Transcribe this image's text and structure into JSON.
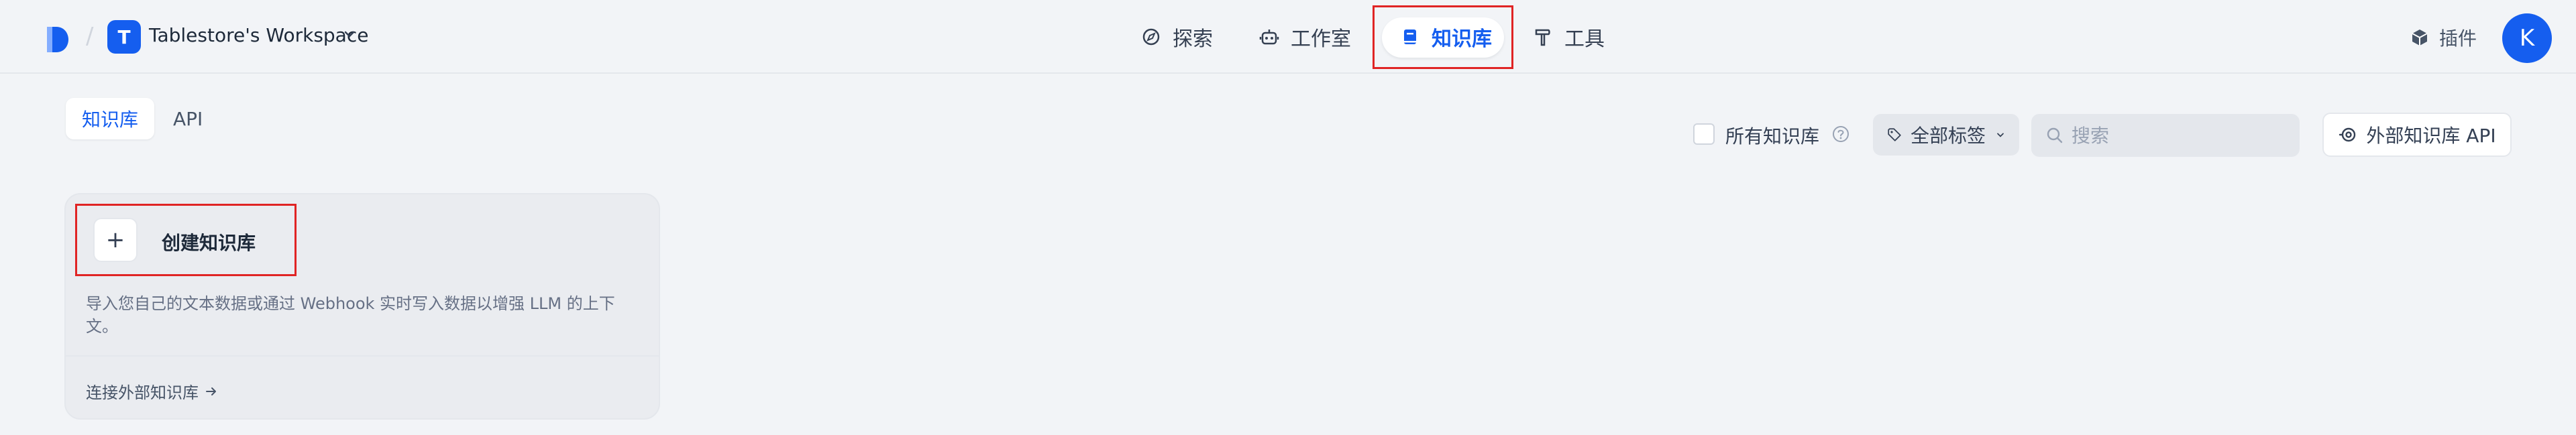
{
  "header": {
    "workspace_initial": "T",
    "workspace_name": "Tablestore's Workspace",
    "nav": [
      {
        "label": "探索",
        "icon": "compass-icon"
      },
      {
        "label": "工作室",
        "icon": "robot-icon"
      },
      {
        "label": "知识库",
        "icon": "book-icon",
        "active": true
      },
      {
        "label": "工具",
        "icon": "hammer-icon"
      }
    ],
    "plugin_label": "插件",
    "user_initial": "K"
  },
  "subtabs": [
    {
      "label": "知识库",
      "active": true
    },
    {
      "label": "API",
      "active": false
    }
  ],
  "toolbar": {
    "all_knowledge_label": "所有知识库",
    "tag_select_label": "全部标签",
    "search_placeholder": "搜索",
    "external_api_label": "外部知识库 API"
  },
  "card": {
    "plus": "+",
    "title": "创建知识库",
    "description": "导入您自己的文本数据或通过 Webhook 实时写入数据以增强 LLM 的上下文。",
    "link": "连接外部知识库"
  },
  "colors": {
    "accent": "#155eef",
    "highlight": "#e02424",
    "background": "#f2f4f7"
  }
}
